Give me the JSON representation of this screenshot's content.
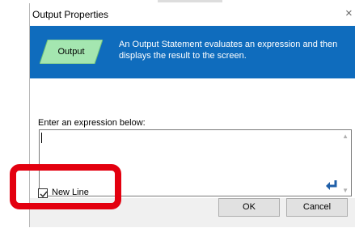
{
  "window": {
    "title": "Output Properties",
    "close_glyph": "×"
  },
  "banner": {
    "shape_label": "Output",
    "description": "An Output Statement evaluates an expression and then displays the result to the screen.",
    "background_color": "#0f6cbd",
    "shape_color": "#a4e6b0"
  },
  "form": {
    "prompt": "Enter an expression below:",
    "expression_value": "",
    "enter_icon": "enter-arrow-icon",
    "scroll_up_glyph": "▲",
    "scroll_down_glyph": "▼"
  },
  "newline": {
    "label": "New Line",
    "checked": true
  },
  "buttons": {
    "ok": "OK",
    "cancel": "Cancel"
  },
  "annotation": {
    "color": "#e3000f"
  }
}
